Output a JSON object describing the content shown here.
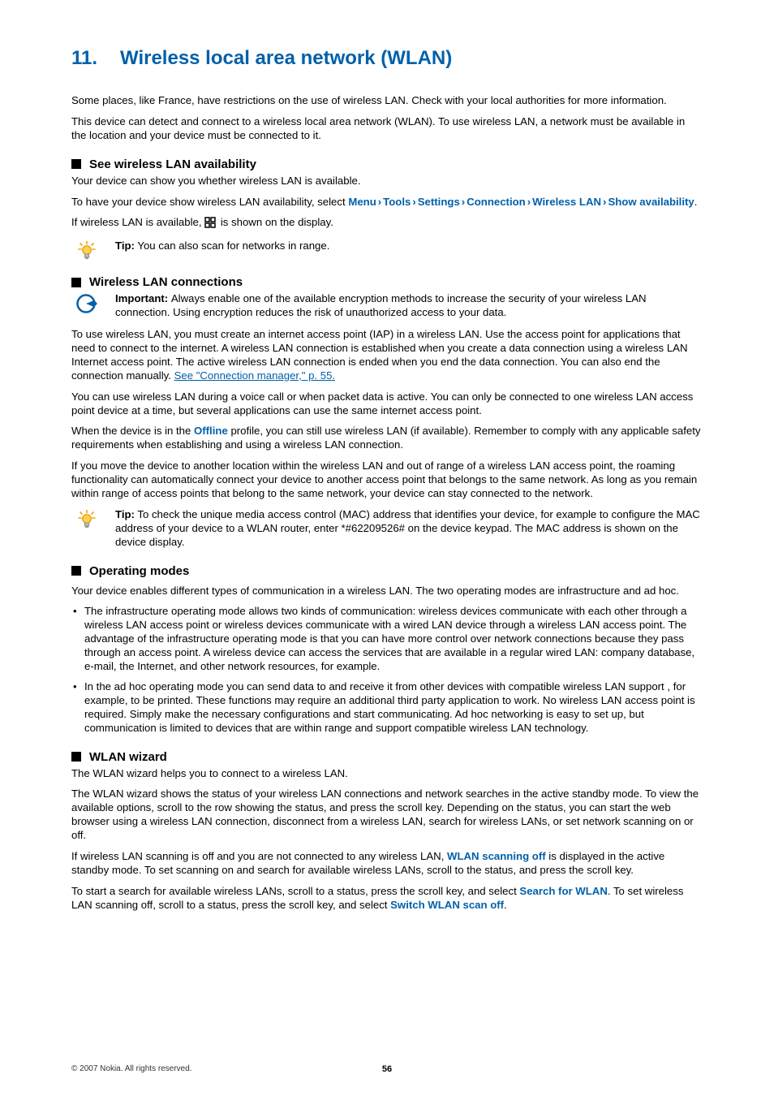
{
  "chapter": {
    "number": "11.",
    "title": "Wireless local area network (WLAN)"
  },
  "intro": {
    "p1": "Some places, like France, have restrictions on the use of wireless LAN. Check with your local authorities for more information.",
    "p2": "This device can detect and connect to a wireless local area network (WLAN). To use wireless LAN, a network must be available in the location and your device must be connected to it."
  },
  "s1": {
    "heading": "See wireless LAN availability",
    "p1": "Your device can show you whether wireless LAN is available.",
    "p2_before": "To have your device show wireless LAN availability, select ",
    "menu": "Menu",
    "tools": "Tools",
    "settings": "Settings",
    "connection": "Connection",
    "wirelessLan": "Wireless LAN",
    "showAvail": "Show availability",
    "p2_after": ".",
    "p3_before": "If wireless LAN is available, ",
    "p3_after": " is shown on the display.",
    "tip_lead": "Tip:",
    "tip_text": " You can also scan for networks in range."
  },
  "s2": {
    "heading": "Wireless LAN connections",
    "imp_lead": "Important: ",
    "imp_text": " Always enable one of the available encryption methods to increase the security of your wireless LAN connection. Using encryption reduces the risk of unauthorized access to your data.",
    "p1": "To use wireless LAN, you must create an internet access point (IAP) in a wireless LAN. Use the access point for applications that need to connect to the internet. A wireless LAN connection is established when you create a data connection using a wireless LAN Internet access point. The active wireless LAN connection is ended when you end the data connection. You can also end the connection manually. ",
    "p1_link": "See \"Connection manager,\" p. 55.",
    "p2": "You can use wireless LAN during a voice call or when packet data is active. You can only be connected to one wireless LAN access point device at a time, but several applications can use the same internet access point.",
    "p3_before": "When the device is in the ",
    "p3_offline": "Offline",
    "p3_after": " profile, you can still use wireless LAN (if available). Remember to comply with any applicable safety requirements when establishing and using a wireless LAN connection.",
    "p4": "If you move the device to another location within the wireless LAN and out of range of a wireless LAN access point, the roaming functionality can automatically connect your device to another access point that belongs to the same network. As long as you remain within range of access points that belong to the same network, your device can stay connected to the network.",
    "tip_lead": "Tip:",
    "tip_text": " To check the unique media access control (MAC) address that identifies your device, for example to configure the MAC address of your device to a WLAN router, enter *#62209526# on the device keypad. The MAC address is shown on the device display."
  },
  "s3": {
    "heading": "Operating modes",
    "p1": "Your device enables different types of communication in a wireless LAN. The two operating modes are infrastructure and ad hoc.",
    "li1": "The infrastructure operating mode allows two kinds of communication: wireless devices communicate with each other through a wireless LAN access point or wireless devices communicate with a wired LAN device through a wireless LAN access point. The advantage of the infrastructure operating mode is that you can have more control over network connections because they pass through an access point. A wireless device can access the services that are available in a regular wired LAN: company database, e-mail, the Internet, and other network resources, for example.",
    "li2": "In the ad hoc operating mode you can send data to and receive it from other devices with compatible wireless LAN support , for example, to be printed. These functions may require an additional third party application to work. No wireless LAN access point is required. Simply make the necessary configurations and start communicating. Ad hoc networking is easy to set up, but communication is limited to devices that are within range and support compatible wireless LAN technology."
  },
  "s4": {
    "heading": "WLAN wizard",
    "p1": "The WLAN wizard helps you to connect to a wireless LAN.",
    "p2": "The WLAN wizard shows the status of your wireless LAN connections and network searches in the active standby mode. To view the available options, scroll to the row showing the status, and press the scroll key. Depending on the status, you can start the web browser using a wireless LAN connection, disconnect from a wireless LAN, search for wireless LANs, or set network scanning on or off.",
    "p3_before": "If wireless LAN scanning is off and you are not connected to any wireless LAN, ",
    "p3_ui": "WLAN scanning off",
    "p3_after": " is displayed in the active standby mode. To set scanning on and search for available wireless LANs, scroll to the status, and press the scroll key.",
    "p4_before": "To start a search for available wireless LANs, scroll to a status, press the scroll key, and select ",
    "p4_ui1": "Search for WLAN",
    "p4_mid": ". To set wireless LAN scanning off, scroll to a status, press the scroll key, and select ",
    "p4_ui2": "Switch WLAN scan off",
    "p4_after": "."
  },
  "footer": {
    "copyright": "© 2007 Nokia. All rights reserved.",
    "page": "56"
  }
}
